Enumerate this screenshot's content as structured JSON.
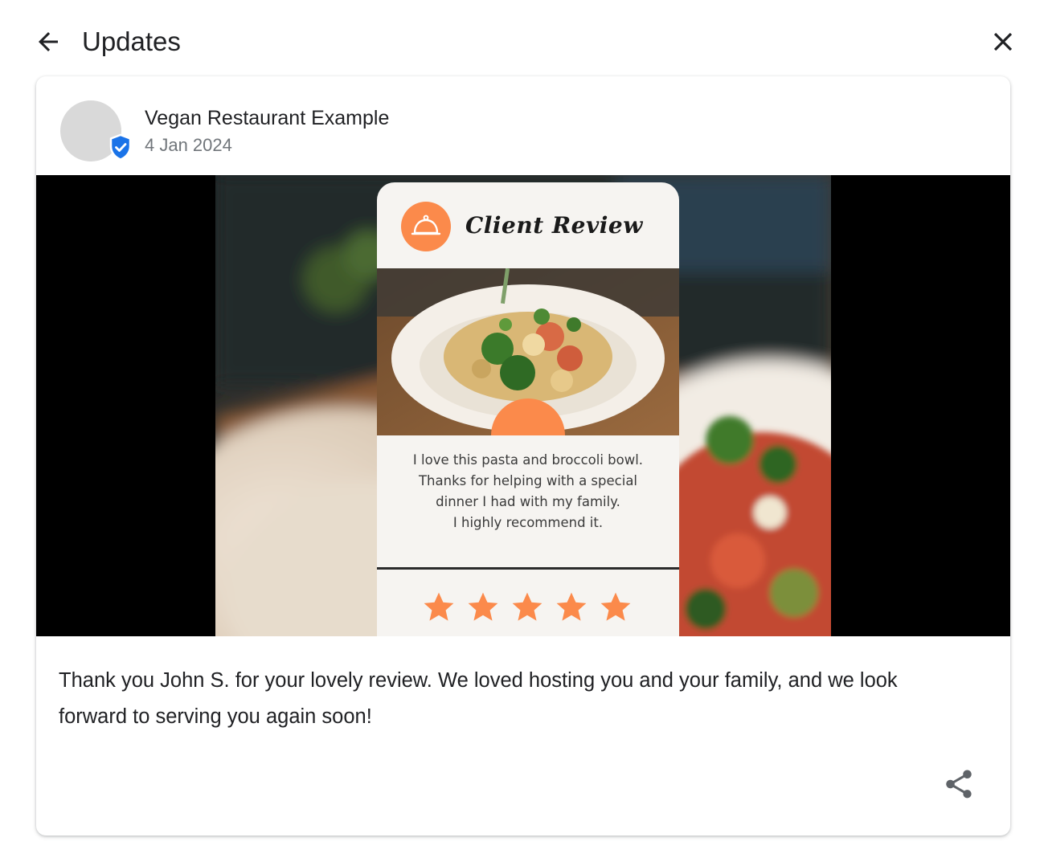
{
  "header": {
    "title": "Updates",
    "back_icon": "arrow-back-icon",
    "close_icon": "close-icon"
  },
  "post": {
    "author": "Vegan Restaurant Example",
    "date": "4 Jan 2024",
    "verified_icon": "verified-shield-icon",
    "body": "Thank you John S. for your lovely review. We loved hosting you and your family, and we look forward to serving you again soon!",
    "share_icon": "share-icon"
  },
  "image": {
    "card_title": "Client Review",
    "card_icon": "food-cloche-icon",
    "review_lines": [
      "I love this pasta and broccoli bowl.",
      "Thanks for helping with a special",
      "dinner I had with  my family.",
      "I highly recommend it."
    ],
    "rating_stars": 5,
    "accent_color": "#fb8a4b"
  },
  "colors": {
    "verified": "#1a73e8",
    "text_primary": "#202124",
    "text_secondary": "#70757a"
  }
}
